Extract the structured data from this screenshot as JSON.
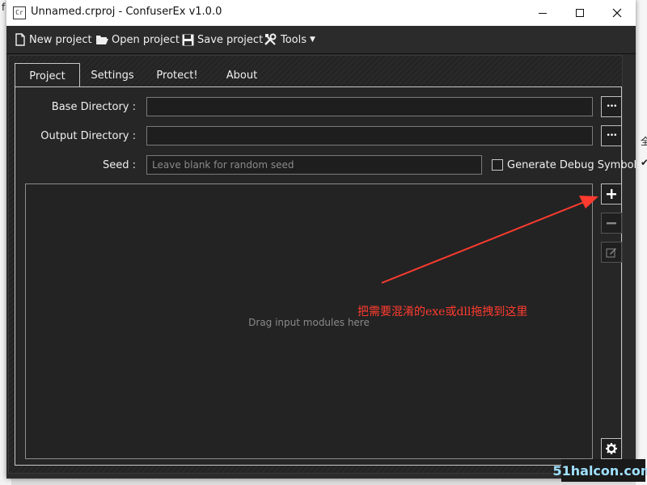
{
  "window": {
    "title": "Unnamed.crproj - ConfuserEx v1.0.0",
    "app_icon_text": "Cr"
  },
  "background": {
    "left_fragment": "f",
    "right_fragment_1": "全",
    "right_fragment_2": "✔"
  },
  "menu": {
    "new_project": "New project",
    "open_project": "Open project",
    "save_project": "Save project",
    "tools": "Tools"
  },
  "tabs": [
    "Project",
    "Settings",
    "Protect!",
    "About"
  ],
  "project": {
    "base_directory_label": "Base Directory :",
    "base_directory_value": "",
    "output_directory_label": "Output Directory :",
    "output_directory_value": "",
    "seed_label": "Seed :",
    "seed_value": "",
    "seed_placeholder": "Leave blank for random seed",
    "debug_symbols_label": "Generate Debug Symbols",
    "debug_symbols_checked": false,
    "browse_label": "•••",
    "drop_text": "Drag input modules here"
  },
  "annotation": {
    "text": "把需要混淆的exe或dll拖拽到这里",
    "color": "#ff3b2f"
  },
  "watermark": "51halcon.com"
}
